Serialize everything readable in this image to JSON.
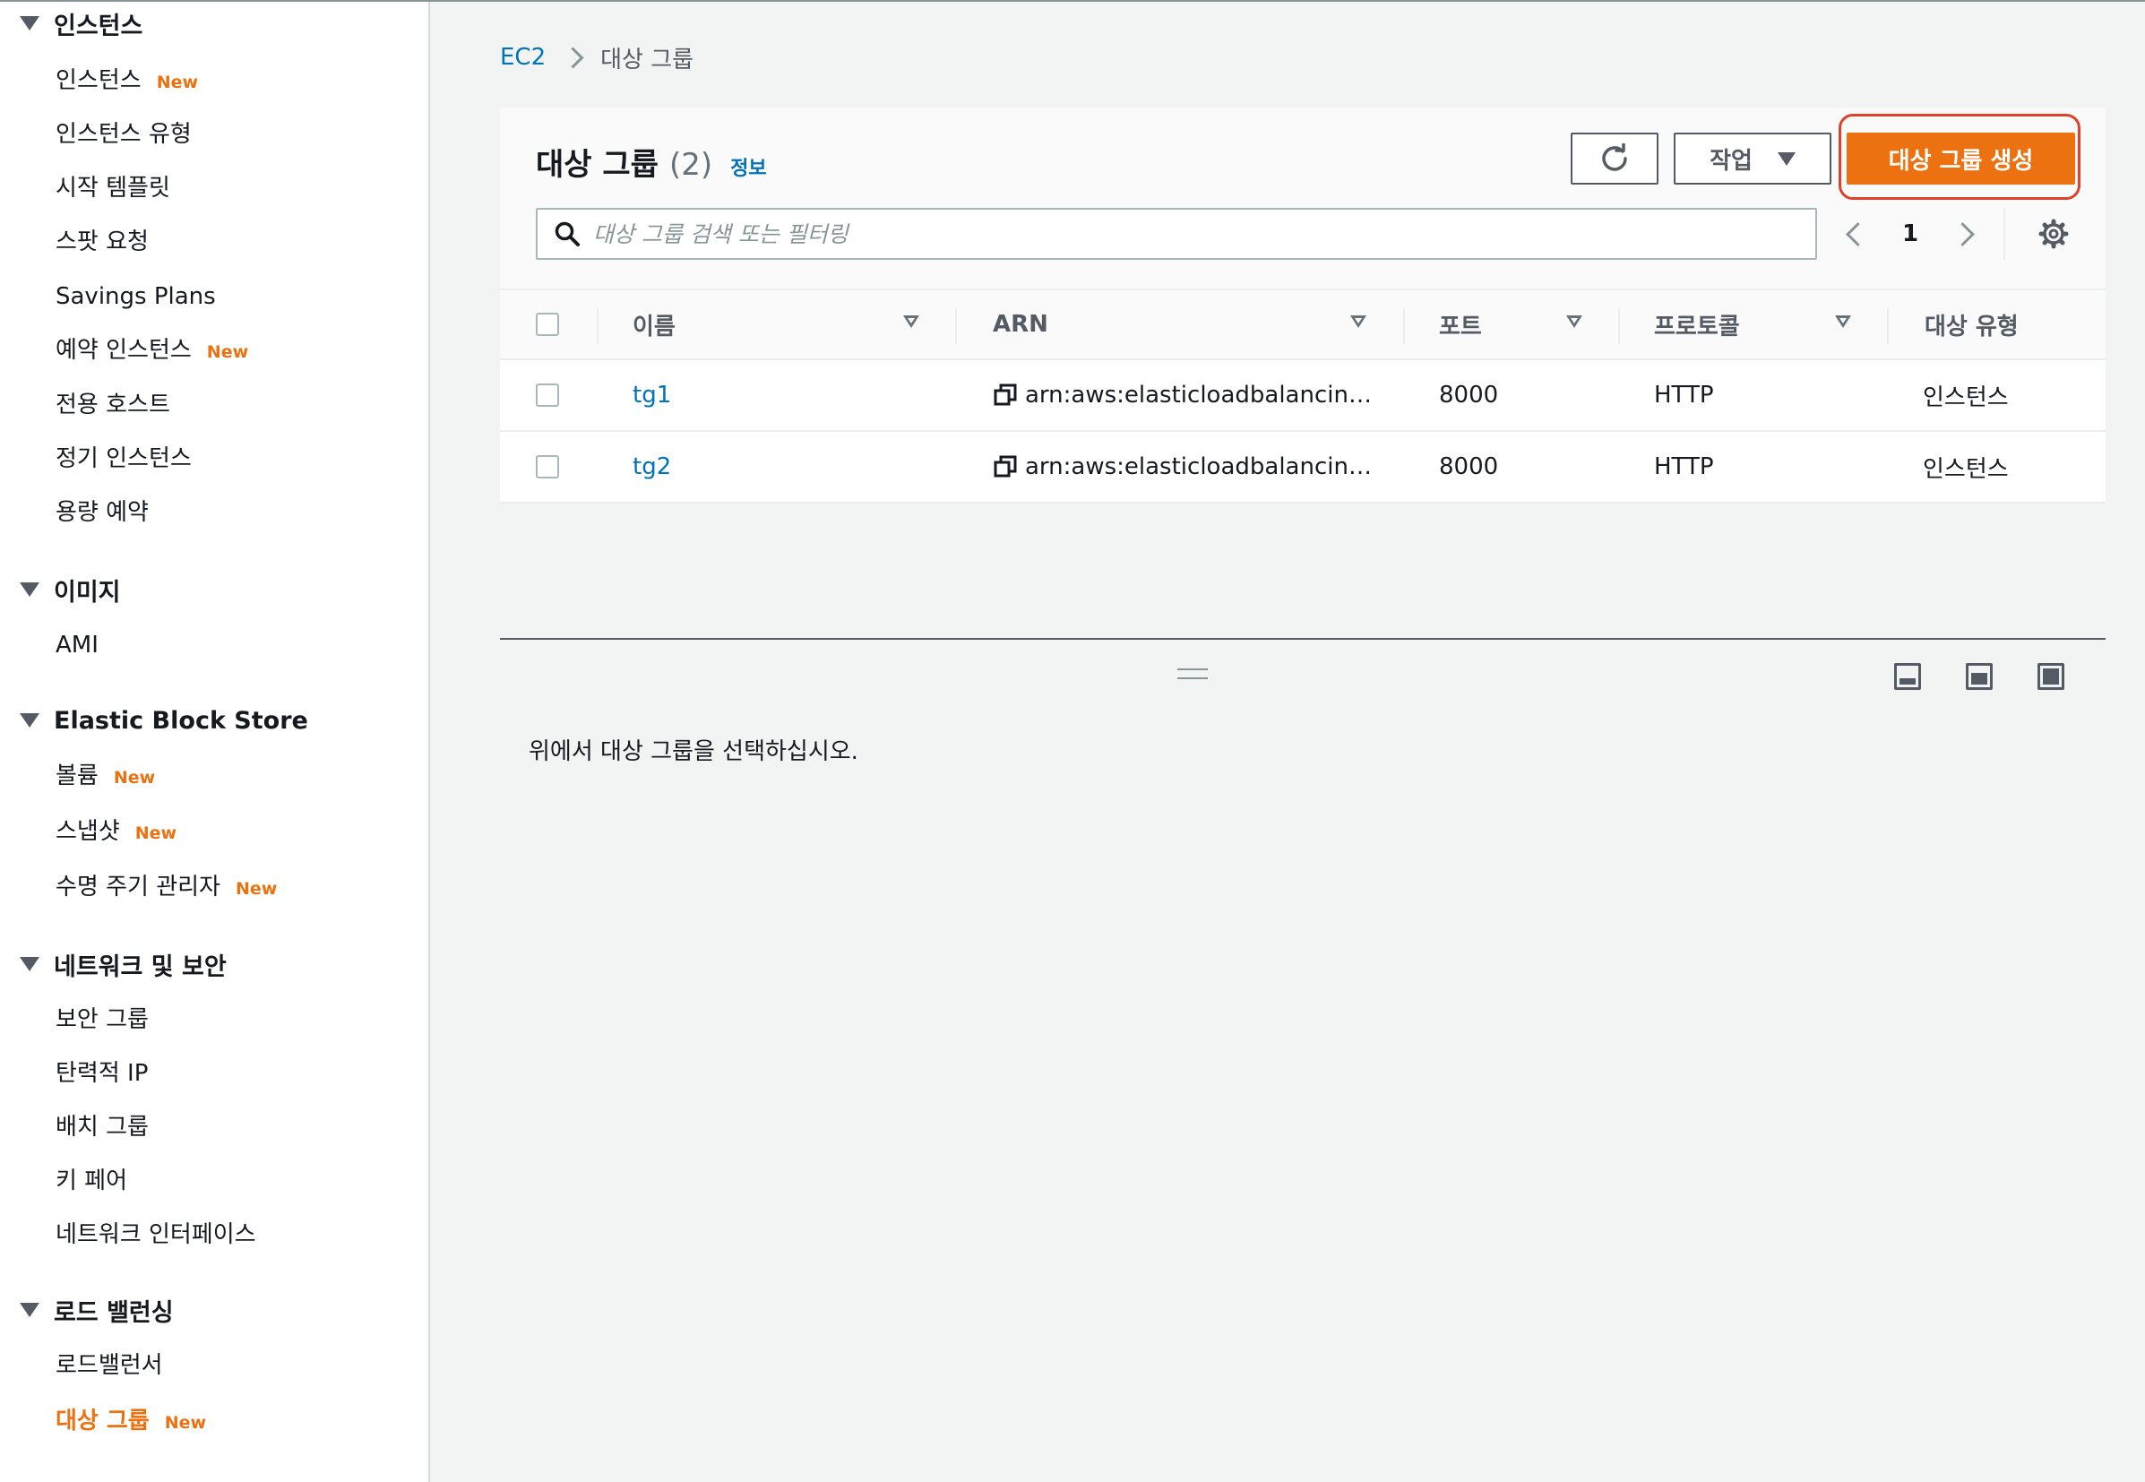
{
  "sidebar": {
    "sections": [
      {
        "label": "인스턴스",
        "items": [
          {
            "label": "인스턴스",
            "badge": "New"
          },
          {
            "label": "인스턴스 유형"
          },
          {
            "label": "시작 템플릿"
          },
          {
            "label": "스팟 요청"
          },
          {
            "label": "Savings Plans"
          },
          {
            "label": "예약 인스턴스",
            "badge": "New"
          },
          {
            "label": "전용 호스트"
          },
          {
            "label": "정기 인스턴스"
          },
          {
            "label": "용량 예약"
          }
        ]
      },
      {
        "label": "이미지",
        "items": [
          {
            "label": "AMI"
          }
        ]
      },
      {
        "label": "Elastic Block Store",
        "items": [
          {
            "label": "볼륨",
            "badge": "New"
          },
          {
            "label": "스냅샷",
            "badge": "New"
          },
          {
            "label": "수명 주기 관리자",
            "badge": "New"
          }
        ]
      },
      {
        "label": "네트워크 및 보안",
        "items": [
          {
            "label": "보안 그룹"
          },
          {
            "label": "탄력적 IP"
          },
          {
            "label": "배치 그룹"
          },
          {
            "label": "키 페어"
          },
          {
            "label": "네트워크 인터페이스"
          }
        ]
      },
      {
        "label": "로드 밸런싱",
        "items": [
          {
            "label": "로드밸런서"
          },
          {
            "label": "대상 그룹",
            "badge": "New",
            "active": true
          }
        ]
      }
    ]
  },
  "breadcrumb": {
    "root": "EC2",
    "current": "대상 그룹"
  },
  "panel": {
    "title": "대상 그룹",
    "count": "(2)",
    "info": "정보",
    "actions_label": "작업",
    "create_label": "대상 그룹 생성",
    "search_placeholder": "대상 그룹 검색 또는 필터링",
    "page": "1"
  },
  "table": {
    "columns": [
      "이름",
      "ARN",
      "포트",
      "프로토콜",
      "대상 유형"
    ],
    "rows": [
      {
        "name": "tg1",
        "arn": "arn:aws:elasticloadbalancin…",
        "port": "8000",
        "protocol": "HTTP",
        "type": "인스턴스"
      },
      {
        "name": "tg2",
        "arn": "arn:aws:elasticloadbalancin…",
        "port": "8000",
        "protocol": "HTTP",
        "type": "인스턴스"
      }
    ]
  },
  "detail": {
    "empty_message": "위에서 대상 그룹을 선택하십시오."
  },
  "colors": {
    "accent": "#ec7211",
    "link": "#0073bb",
    "highlight": "#e0412b"
  }
}
